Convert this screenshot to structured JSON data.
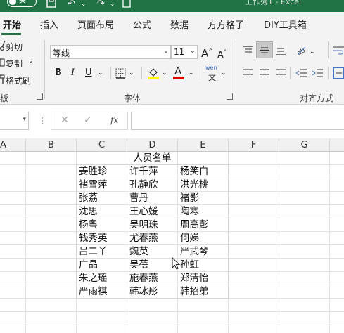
{
  "titlebar": {
    "autosave_state": "关",
    "doc_title": "工作簿1 - Excel"
  },
  "tabs": [
    "开始",
    "插入",
    "页面布局",
    "公式",
    "数据",
    "方方格子",
    "DIY工具箱"
  ],
  "clipboard": {
    "cut": "剪切",
    "copy": "复制",
    "format_painter": "格式刷",
    "group_label": "板"
  },
  "font": {
    "name": "等线",
    "size": "11",
    "bold": "B",
    "italic": "I",
    "underline": "U",
    "font_color_letter": "A",
    "wen": "wén",
    "wen_char": "文",
    "group_label": "字体",
    "highlight_color": "#ffff00",
    "font_color": "#e00000"
  },
  "alignment": {
    "group_label": "对齐方式"
  },
  "formula_bar": {
    "cancel": "✕",
    "enter": "✓",
    "fx": "fx"
  },
  "columns": [
    "A",
    "B",
    "C",
    "D",
    "E",
    "F",
    "G"
  ],
  "sheet": {
    "title": "人员名单",
    "rows": [
      [
        "姜胜珍",
        "许千萍",
        "杨笑白"
      ],
      [
        "褚雪萍",
        "孔静欣",
        "洪光桃"
      ],
      [
        "张荔",
        "曹丹",
        "褚影"
      ],
      [
        "沈思",
        "王心媛",
        "陶寒"
      ],
      [
        "杨粤",
        "吴明珠",
        "周高彭"
      ],
      [
        "钱秀英",
        "尤春燕",
        "何娣"
      ],
      [
        "吕二丫",
        "魏英",
        "严武琴"
      ],
      [
        "广晶",
        "吴蓓",
        "孙虹"
      ],
      [
        "朱之瑶",
        "施春燕",
        "郑清怡"
      ],
      [
        "严雨祺",
        "韩冰彤",
        "韩招弟"
      ]
    ]
  }
}
